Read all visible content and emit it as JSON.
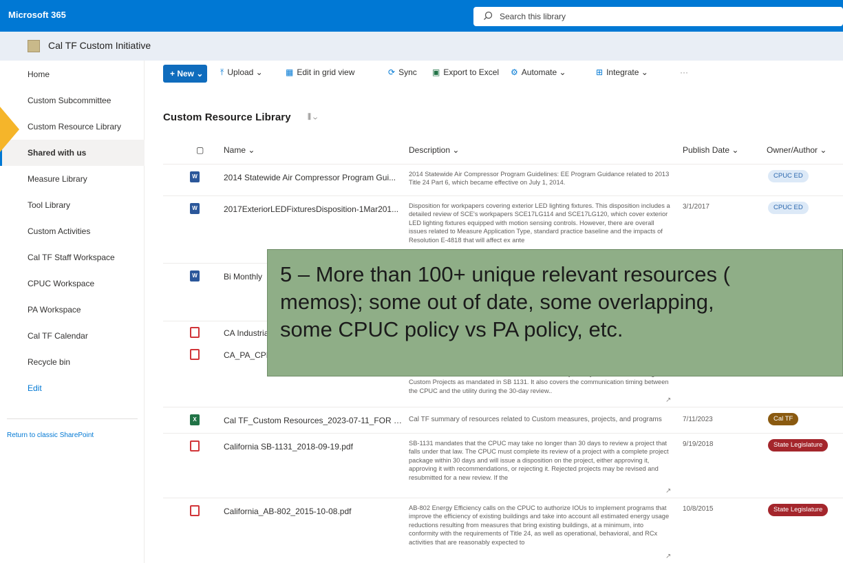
{
  "topbar": {
    "brand": "Microsoft 365",
    "search_placeholder": "Search this library"
  },
  "site": {
    "title": "Cal TF Custom Initiative"
  },
  "nav": {
    "items": [
      {
        "label": "Home"
      },
      {
        "label": "Custom Subcommittee"
      },
      {
        "label": "Custom Resource Library"
      },
      {
        "label": "Shared with us"
      },
      {
        "label": "Measure Library"
      },
      {
        "label": "Tool Library"
      },
      {
        "label": "Custom Activities"
      },
      {
        "label": "Cal TF Staff Workspace"
      },
      {
        "label": "CPUC Workspace"
      },
      {
        "label": "PA Workspace"
      },
      {
        "label": "Cal TF Calendar"
      },
      {
        "label": "Recycle bin"
      },
      {
        "label": "Edit"
      }
    ],
    "selected": "Shared with us",
    "classic_link": "Return to classic SharePoint"
  },
  "commandbar": {
    "new": "New",
    "upload": "Upload",
    "edit_grid": "Edit in grid view",
    "sync": "Sync",
    "export": "Export to Excel",
    "automate": "Automate",
    "integrate": "Integrate",
    "more": "···"
  },
  "library": {
    "title": "Custom Resource Library",
    "columns": {
      "name": "Name",
      "description": "Description",
      "publish_date": "Publish Date",
      "owner": "Owner/Author"
    },
    "rows": [
      {
        "type": "word",
        "name": "2014 Statewide Air Compressor Program Gui...",
        "description": "2014 Statewide Air Compressor Program Guidelines: EE Program Guidance related to 2013 Title 24 Part 6, which became effective on July 1, 2014.",
        "date": "",
        "owner": "CPUC ED",
        "owner_style": "cpuc"
      },
      {
        "type": "word",
        "name": "2017ExteriorLEDFixturesDisposition-1Mar201...",
        "description": "Disposition for workpapers covering exterior LED lighting fixtures. This disposition includes a detailed review of SCE's workpapers SCE17LG114 and SCE17LG120, which cover exterior LED lighting fixtures equipped with motion sensing controls. However, there are overall issues related to Measure Application Type, standard practice baseline and the impacts of Resolution E-4818 that will affect ex ante",
        "date": "3/1/2017",
        "owner": "CPUC ED",
        "owner_style": "cpuc"
      },
      {
        "type": "word",
        "name": "Bi Monthly",
        "description": "",
        "date": "",
        "owner": "",
        "owner_style": ""
      },
      {
        "type": "pdf",
        "name": "CA Industria",
        "description": "",
        "date": "",
        "owner": "",
        "owner_style": ""
      },
      {
        "type": "pdf",
        "name": "CA_PA_CPR",
        "description": "stakeholders. This document details the CPUC staff's day 30-day timeline for reviewing Custom Projects as mandated in SB 1131. It also covers the communication timing between the CPUC and the utility during the 30-day review..",
        "date": "",
        "owner": "",
        "owner_style": ""
      },
      {
        "type": "xls",
        "name": "Cal TF_Custom Resources_2023-07-11_FOR R...",
        "description": "Cal TF summary of resources related to Custom measures, projects, and programs",
        "date": "7/11/2023",
        "owner": "Cal TF",
        "owner_style": "caltf"
      },
      {
        "type": "pdf",
        "name": "California SB-1131_2018-09-19.pdf",
        "description": "SB-1131 mandates that the CPUC may take no longer than 30 days to review a project that falls under that law. The CPUC must complete its review of a project with a complete project package within 30 days and will issue a disposition on the project, either approving it, approving it with recommendations, or rejecting it. Rejected projects may be revised and resubmitted for a new review. If the",
        "date": "9/19/2018",
        "owner": "State Legislature",
        "owner_style": "leg"
      },
      {
        "type": "pdf",
        "name": "California_AB-802_2015-10-08.pdf",
        "description": "AB-802 Energy Efficiency calls on the CPUC to authorize IOUs to implement programs that improve the efficiency of existing buildings and take into account all estimated energy usage reductions resulting from measures that bring existing buildings, at a minimum, into conformity with the requirements of Title 24, as well as operational, behavioral, and RCx activities that are reasonably expected to",
        "date": "10/8/2015",
        "owner": "State Legislature",
        "owner_style": "leg"
      }
    ]
  },
  "overlay": {
    "line1": "5 – More than 100+ unique relevant resources (",
    "line2": "memos); some out of date, some overlapping,",
    "line3": "some CPUC policy vs PA policy, etc."
  },
  "colors": {
    "accent": "#0078d4",
    "overlay": "#8fae87",
    "arrow": "#f5b52a"
  }
}
